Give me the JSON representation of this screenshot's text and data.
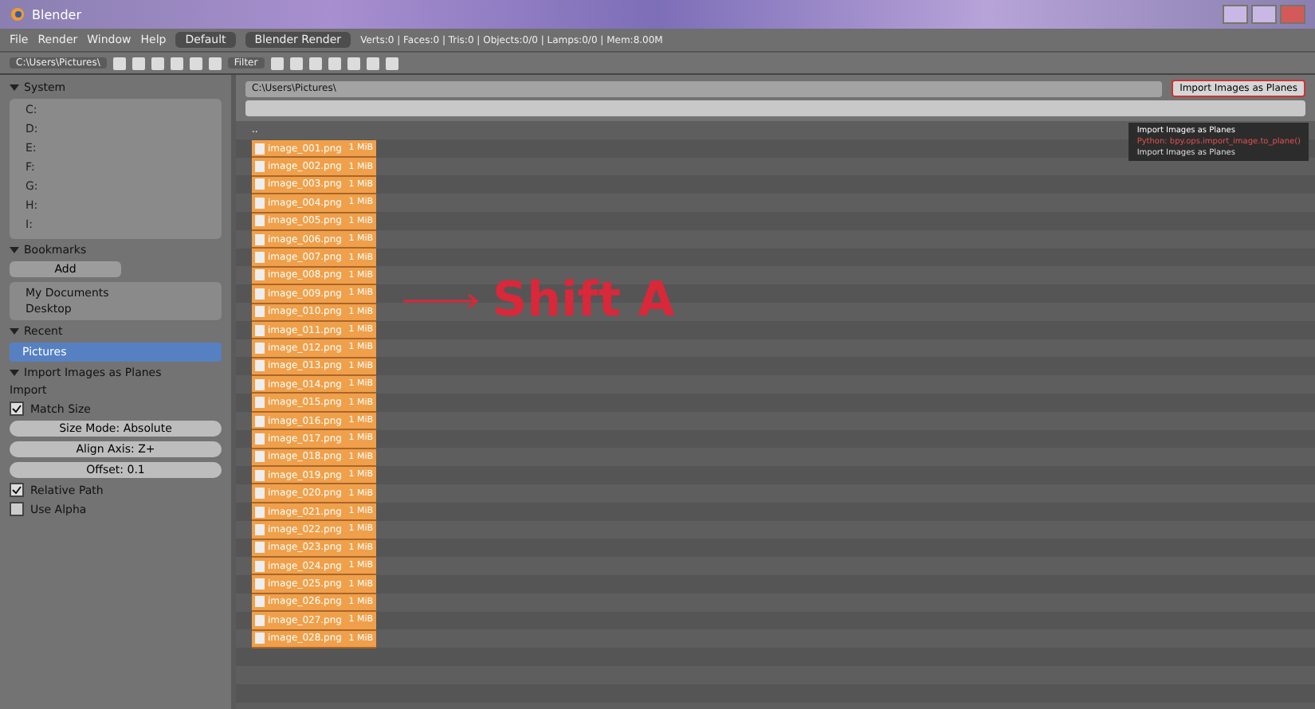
{
  "window": {
    "title": "Blender"
  },
  "menu": [
    "File",
    "Render",
    "Window",
    "Help"
  ],
  "header": {
    "screen": "Default",
    "engine": "Blender Render",
    "info": "Verts:0 | Faces:0 | Tris:0 | Objects:0/0 | Lamps:0/0 | Mem:8.00M"
  },
  "toolbar": {
    "path_label": "C:\\Users\\Pictures\\",
    "filter": "Filter"
  },
  "sidebar": {
    "system": {
      "title": "System",
      "drives": [
        "C:",
        "D:",
        "E:",
        "F:",
        "G:",
        "H:",
        "I:"
      ]
    },
    "bookmarks": {
      "title": "Bookmarks",
      "add": "Add",
      "items": [
        "My Documents",
        "Desktop"
      ]
    },
    "recent": {
      "title": "Recent",
      "items": [
        {
          "label": "Pictures",
          "selected": true
        }
      ]
    },
    "options": {
      "title": "Import Images as Planes",
      "sub": "Import",
      "checks": [
        {
          "label": "Match Size",
          "checked": true,
          "kind": "check"
        },
        {
          "label": "Size Mode: Absolute",
          "kind": "button"
        },
        {
          "label": "Align Axis: Z+",
          "kind": "button"
        },
        {
          "label": "Offset: 0.1",
          "kind": "button"
        },
        {
          "label": "Relative Path",
          "checked": true,
          "kind": "check"
        },
        {
          "label": "Use Alpha",
          "checked": false,
          "kind": "check"
        }
      ]
    }
  },
  "file_browser": {
    "directory": "C:\\Users\\Pictures\\",
    "parent": "..",
    "files": [
      {
        "name": "image_001.png",
        "size": "1 MiB",
        "selected": true
      },
      {
        "name": "image_002.png",
        "size": "1 MiB",
        "selected": true
      },
      {
        "name": "image_003.png",
        "size": "1 MiB",
        "selected": true
      },
      {
        "name": "image_004.png",
        "size": "1 MiB",
        "selected": true
      },
      {
        "name": "image_005.png",
        "size": "1 MiB",
        "selected": true
      },
      {
        "name": "image_006.png",
        "size": "1 MiB",
        "selected": true
      },
      {
        "name": "image_007.png",
        "size": "1 MiB",
        "selected": true
      },
      {
        "name": "image_008.png",
        "size": "1 MiB",
        "selected": true
      },
      {
        "name": "image_009.png",
        "size": "1 MiB",
        "selected": true
      },
      {
        "name": "image_010.png",
        "size": "1 MiB",
        "selected": true
      },
      {
        "name": "image_011.png",
        "size": "1 MiB",
        "selected": true
      },
      {
        "name": "image_012.png",
        "size": "1 MiB",
        "selected": true
      },
      {
        "name": "image_013.png",
        "size": "1 MiB",
        "selected": true
      },
      {
        "name": "image_014.png",
        "size": "1 MiB",
        "selected": true
      },
      {
        "name": "image_015.png",
        "size": "1 MiB",
        "selected": true
      },
      {
        "name": "image_016.png",
        "size": "1 MiB",
        "selected": true
      },
      {
        "name": "image_017.png",
        "size": "1 MiB",
        "selected": true
      },
      {
        "name": "image_018.png",
        "size": "1 MiB",
        "selected": true
      },
      {
        "name": "image_019.png",
        "size": "1 MiB",
        "selected": true
      },
      {
        "name": "image_020.png",
        "size": "1 MiB",
        "selected": true
      },
      {
        "name": "image_021.png",
        "size": "1 MiB",
        "selected": true
      },
      {
        "name": "image_022.png",
        "size": "1 MiB",
        "selected": true
      },
      {
        "name": "image_023.png",
        "size": "1 MiB",
        "selected": true
      },
      {
        "name": "image_024.png",
        "size": "1 MiB",
        "selected": true
      },
      {
        "name": "image_025.png",
        "size": "1 MiB",
        "selected": true
      },
      {
        "name": "image_026.png",
        "size": "1 MiB",
        "selected": true
      },
      {
        "name": "image_027.png",
        "size": "1 MiB",
        "selected": true
      },
      {
        "name": "image_028.png",
        "size": "1 MiB",
        "selected": true
      }
    ],
    "annotation": "Shift A",
    "import_button": "Import Images as Planes",
    "tooltip": [
      "Import Images as Planes",
      "Python: bpy.ops.import_image.to_plane()",
      "Import Images as Planes"
    ]
  }
}
